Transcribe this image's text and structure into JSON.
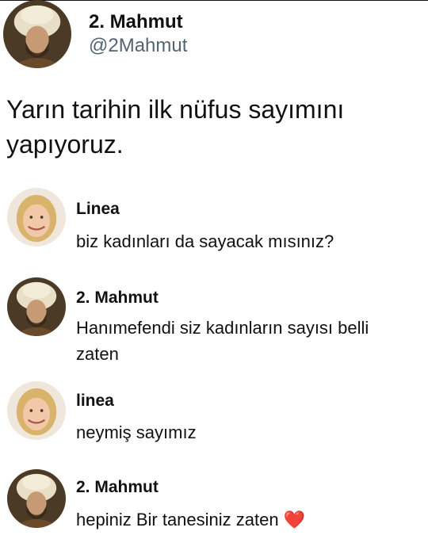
{
  "post": {
    "author_name": "2. Mahmut",
    "author_handle": "@2Mahmut",
    "text": "Yarın tarihin ilk nüfus sayımını yapıyoruz.",
    "avatar_icon": "ottoman-sultan-portrait"
  },
  "replies": [
    {
      "name": "Linea",
      "text": "biz kadınları da sayacak mısınız?",
      "avatar_icon": "blonde-woman-portrait"
    },
    {
      "name": "2. Mahmut",
      "text": "Hanımefendi siz kadınların sayısı belli zaten",
      "avatar_icon": "ottoman-sultan-portrait"
    },
    {
      "name": "linea",
      "text": "neymiş sayımız",
      "avatar_icon": "blonde-woman-portrait"
    },
    {
      "name": "2. Mahmut",
      "text": "hepiniz Bir tanesiniz zaten",
      "emoji": "❤️",
      "avatar_icon": "ottoman-sultan-portrait"
    }
  ],
  "colors": {
    "text": "#111111",
    "handle": "#536471",
    "heart": "#e0202c"
  }
}
